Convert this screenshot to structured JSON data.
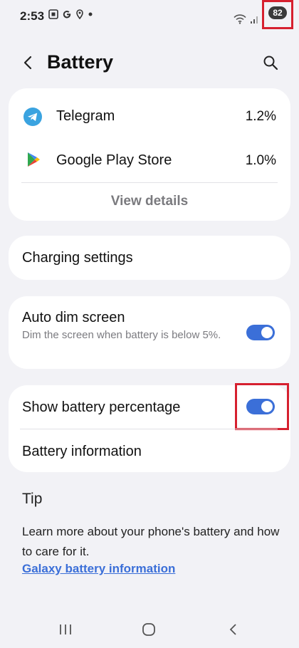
{
  "status_bar": {
    "time": "2:53",
    "battery_level": "82",
    "notification_icons": [
      "screenshot-icon",
      "google-icon",
      "location-icon",
      "dot-icon"
    ]
  },
  "header": {
    "title": "Battery"
  },
  "usage": {
    "apps": [
      {
        "name": "Telegram",
        "percent": "1.2%",
        "icon": "telegram-icon"
      },
      {
        "name": "Google Play Store",
        "percent": "1.0%",
        "icon": "play-store-icon"
      }
    ],
    "view_details_label": "View details"
  },
  "charging": {
    "label": "Charging settings"
  },
  "auto_dim": {
    "title": "Auto dim screen",
    "subtitle": "Dim the screen when battery is below 5%.",
    "enabled": true
  },
  "settings": {
    "show_percentage_label": "Show battery percentage",
    "show_percentage_enabled": true,
    "battery_info_label": "Battery information"
  },
  "tip": {
    "heading": "Tip",
    "body": "Learn more about your phone's battery and how to care for it.",
    "link": "Galaxy battery information"
  },
  "colors": {
    "accent": "#3b6fd8",
    "highlight": "#d6202f",
    "background": "#f2f2f6"
  }
}
